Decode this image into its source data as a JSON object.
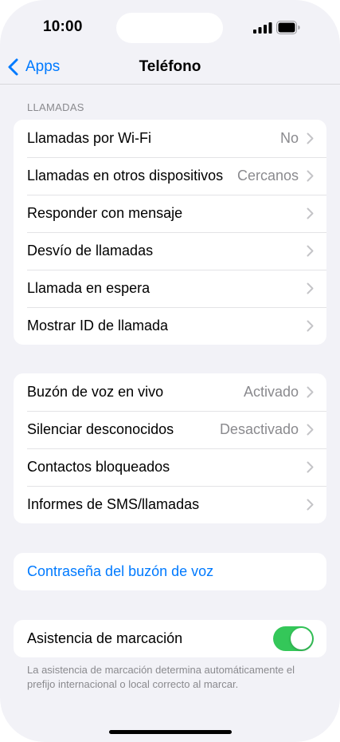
{
  "status_bar": {
    "time": "10:00"
  },
  "nav": {
    "back_label": "Apps",
    "title": "Teléfono"
  },
  "calls_section": {
    "header": "LLAMADAS",
    "rows": [
      {
        "label": "Llamadas por Wi‑Fi",
        "value": "No"
      },
      {
        "label": "Llamadas en otros dispositivos",
        "value": "Cercanos"
      },
      {
        "label": "Responder con mensaje",
        "value": ""
      },
      {
        "label": "Desvío de llamadas",
        "value": ""
      },
      {
        "label": "Llamada en espera",
        "value": ""
      },
      {
        "label": "Mostrar ID de llamada",
        "value": ""
      }
    ]
  },
  "second_section": {
    "rows": [
      {
        "label": "Buzón de voz en vivo",
        "value": "Activado"
      },
      {
        "label": "Silenciar desconocidos",
        "value": "Desactivado"
      },
      {
        "label": "Contactos bloqueados",
        "value": ""
      },
      {
        "label": "Informes de SMS/llamadas",
        "value": ""
      }
    ]
  },
  "voicemail_password": {
    "label": "Contraseña del buzón de voz"
  },
  "dial_assist": {
    "label": "Asistencia de marcación",
    "enabled": true,
    "footer": "La asistencia de marcación determina automáticamente el prefijo internacional o local correcto al marcar."
  },
  "colors": {
    "accent": "#007aff",
    "toggle_on": "#34c759",
    "background": "#f2f2f7"
  }
}
